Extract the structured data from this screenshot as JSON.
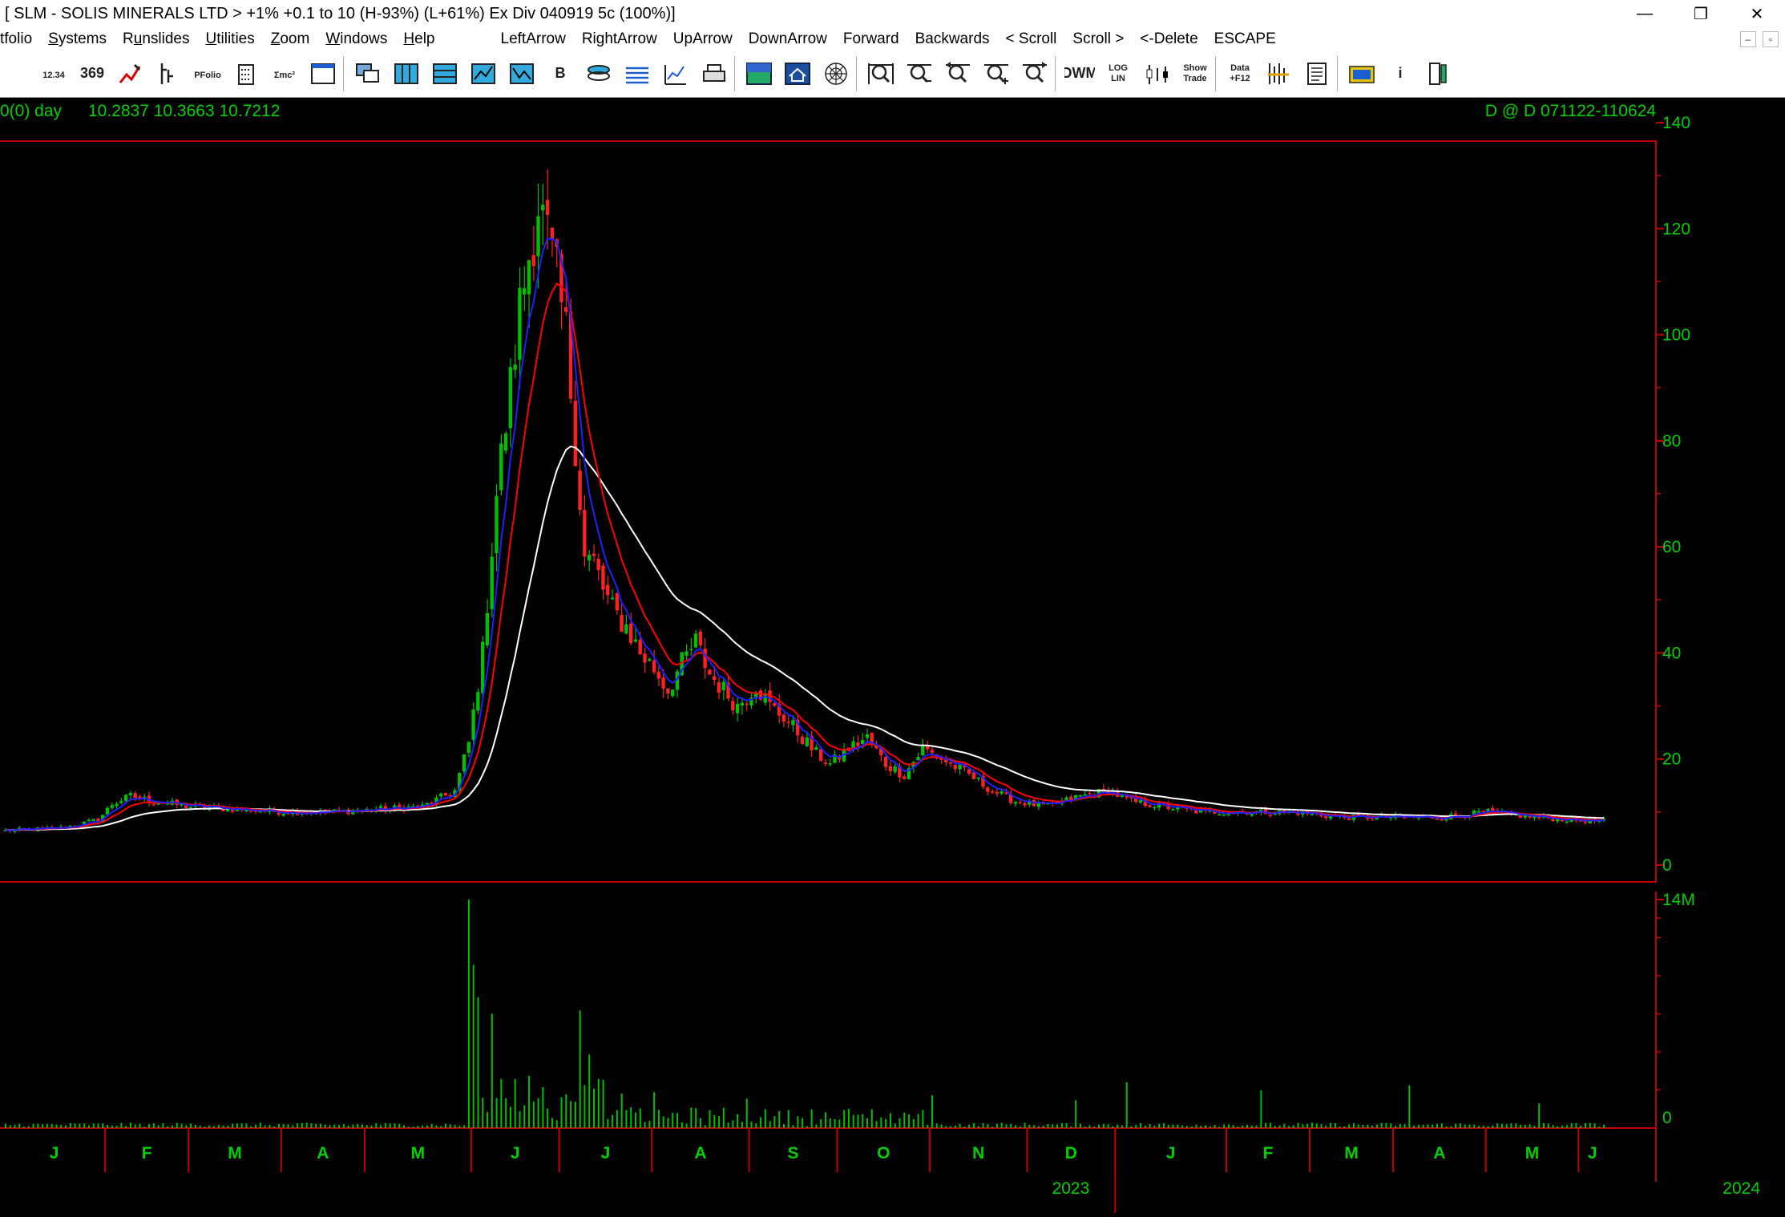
{
  "window": {
    "title": "[ SLM - SOLIS MINERALS LTD > +1% +0.1 to 10 (H-93%) (L+61%)    Ex Div 040919  5c  (100%)]",
    "controls": [
      "—",
      "❐",
      "✕"
    ]
  },
  "menu": {
    "items": [
      {
        "pre": "",
        "ul": "",
        "post": "tfolio"
      },
      {
        "pre": "",
        "ul": "S",
        "post": "ystems"
      },
      {
        "pre": "R",
        "ul": "u",
        "post": "nslides"
      },
      {
        "pre": "",
        "ul": "U",
        "post": "tilities"
      },
      {
        "pre": "",
        "ul": "Z",
        "post": "oom"
      },
      {
        "pre": "",
        "ul": "W",
        "post": "indows"
      },
      {
        "pre": "",
        "ul": "H",
        "post": "elp"
      }
    ],
    "commands": [
      "LeftArrow",
      "RightArrow",
      "UpArrow",
      "DownArrow",
      "Forward",
      "Backwards",
      "< Scroll",
      "Scroll >",
      "<-Delete",
      "ESCAPE"
    ],
    "child_controls": [
      "–",
      "▫"
    ]
  },
  "toolbar": {
    "buttons": [
      {
        "icon": "clock-icon",
        "label": ""
      },
      {
        "icon": "chart-numbers-icon",
        "label": "12.34"
      },
      {
        "icon": "price-table-icon",
        "label": "369"
      },
      {
        "icon": "edit-chart-icon",
        "label": ""
      },
      {
        "icon": "bar-chart-icon",
        "label": ""
      },
      {
        "icon": "portfolio-icon",
        "label": "PFolio"
      },
      {
        "icon": "calculator-icon",
        "label": ""
      },
      {
        "icon": "formula-icon",
        "label": "Σmc²"
      },
      {
        "icon": "window-icon",
        "label": ""
      },
      {
        "icon": "cascade-icon",
        "label": ""
      },
      {
        "icon": "tile-vertical-icon",
        "label": ""
      },
      {
        "icon": "tile-horizontal-icon",
        "label": ""
      },
      {
        "icon": "area-chart-icon",
        "label": ""
      },
      {
        "icon": "volume-chart-icon",
        "label": ""
      },
      {
        "icon": "b-chart-icon",
        "label": "B"
      },
      {
        "icon": "stack-icon",
        "label": ""
      },
      {
        "icon": "layers-icon",
        "label": ""
      },
      {
        "icon": "indicator-icon",
        "label": ""
      },
      {
        "icon": "printer-icon",
        "label": ""
      },
      {
        "icon": "landscape-icon",
        "label": ""
      },
      {
        "icon": "home-icon",
        "label": ""
      },
      {
        "icon": "web-icon",
        "label": ""
      },
      {
        "icon": "zoom-full-icon",
        "label": ""
      },
      {
        "icon": "zoom-out-icon",
        "label": ""
      },
      {
        "icon": "zoom-left-icon",
        "label": ""
      },
      {
        "icon": "zoom-in-icon",
        "label": ""
      },
      {
        "icon": "zoom-right-icon",
        "label": ""
      },
      {
        "icon": "period-dwm-icon",
        "label": "DWM"
      },
      {
        "icon": "log-lin-icon",
        "label": "LOG LIN"
      },
      {
        "icon": "candle-icon",
        "label": ""
      },
      {
        "icon": "show-trade-icon",
        "label": "Show Trade"
      },
      {
        "icon": "data-f12-icon",
        "label": "Data +F12"
      },
      {
        "icon": "signal-icon",
        "label": ""
      },
      {
        "icon": "notes-icon",
        "label": ""
      },
      {
        "icon": "folder-icon",
        "label": ""
      },
      {
        "icon": "info-icon",
        "label": "i"
      },
      {
        "icon": "report-icon",
        "label": ""
      }
    ]
  },
  "chart_header": {
    "left_prefix": "0(0)  day",
    "values": "10.2837  10.3663  10.7212",
    "right": "D @ D   071122-110624"
  },
  "colors": {
    "up": "#00c000",
    "down": "#ff2020",
    "ma_fast": "#2020ff",
    "ma_mid": "#ff0000",
    "ma_slow": "#ffffff",
    "axis": "#00d000",
    "frame": "#c00000",
    "volume": "#00c000"
  },
  "chart_data": {
    "type": "line",
    "price_axis": {
      "ticks": [
        0,
        20,
        40,
        60,
        80,
        100,
        120,
        140
      ],
      "ylim": [
        0,
        140
      ]
    },
    "volume_axis": {
      "ticks": [
        "14M",
        "0"
      ],
      "ylim": [
        0,
        14
      ]
    },
    "x_month_labels": [
      "J",
      "F",
      "M",
      "A",
      "M",
      "J",
      "J",
      "A",
      "S",
      "O",
      "N",
      "D",
      "J",
      "F",
      "M",
      "A",
      "M",
      "J"
    ],
    "year_labels": [
      "2023",
      "2024"
    ],
    "price_path": [
      [
        0,
        6.5
      ],
      [
        12,
        7
      ],
      [
        20,
        8.5
      ],
      [
        23,
        11.5
      ],
      [
        27,
        13
      ],
      [
        32,
        12
      ],
      [
        40,
        11
      ],
      [
        50,
        10.5
      ],
      [
        60,
        10
      ],
      [
        70,
        10
      ],
      [
        80,
        10.5
      ],
      [
        90,
        11
      ],
      [
        97,
        14
      ],
      [
        100,
        23
      ],
      [
        103,
        40
      ],
      [
        106,
        70
      ],
      [
        109,
        90
      ],
      [
        111,
        105
      ],
      [
        113,
        115
      ],
      [
        115,
        125
      ],
      [
        117,
        118
      ],
      [
        119,
        110
      ],
      [
        121,
        100
      ],
      [
        123,
        80
      ],
      [
        125,
        58
      ],
      [
        127,
        57
      ],
      [
        129,
        52
      ],
      [
        131,
        48
      ],
      [
        134,
        45
      ],
      [
        137,
        40
      ],
      [
        140,
        37
      ],
      [
        143,
        33
      ],
      [
        146,
        38
      ],
      [
        149,
        42
      ],
      [
        152,
        36
      ],
      [
        155,
        33
      ],
      [
        158,
        30
      ],
      [
        162,
        34
      ],
      [
        165,
        30
      ],
      [
        168,
        28
      ],
      [
        172,
        24
      ],
      [
        175,
        21
      ],
      [
        178,
        19
      ],
      [
        182,
        22
      ],
      [
        186,
        24
      ],
      [
        190,
        19
      ],
      [
        194,
        17
      ],
      [
        198,
        22
      ],
      [
        202,
        20
      ],
      [
        208,
        17
      ],
      [
        213,
        14
      ],
      [
        218,
        12
      ],
      [
        225,
        11
      ],
      [
        232,
        13
      ],
      [
        238,
        14
      ],
      [
        243,
        12
      ],
      [
        250,
        11
      ],
      [
        258,
        10
      ],
      [
        268,
        10
      ],
      [
        278,
        10
      ],
      [
        288,
        9
      ],
      [
        298,
        9
      ],
      [
        310,
        9
      ],
      [
        320,
        10
      ],
      [
        330,
        9
      ],
      [
        338,
        8.5
      ],
      [
        345,
        8.2
      ]
    ],
    "series": [
      {
        "name": "",
        "period": 5
      },
      {
        "name": "",
        "period": 10
      },
      {
        "name": "",
        "period": 30
      }
    ],
    "volume_spikes": [
      {
        "bar": 100,
        "value": 14
      },
      {
        "bar": 101,
        "value": 10
      },
      {
        "bar": 102,
        "value": 8
      },
      {
        "bar": 105,
        "value": 7
      },
      {
        "bar": 107,
        "value": 3
      },
      {
        "bar": 110,
        "value": 3
      },
      {
        "bar": 113,
        "value": 3.2
      },
      {
        "bar": 116,
        "value": 2.5
      },
      {
        "bar": 124,
        "value": 7.2
      },
      {
        "bar": 126,
        "value": 4.5
      },
      {
        "bar": 128,
        "value": 3
      },
      {
        "bar": 140,
        "value": 2.2
      },
      {
        "bar": 160,
        "value": 1.8
      },
      {
        "bar": 200,
        "value": 2
      },
      {
        "bar": 231,
        "value": 1.7
      },
      {
        "bar": 242,
        "value": 2.8
      },
      {
        "bar": 271,
        "value": 2.3
      },
      {
        "bar": 303,
        "value": 2.6
      },
      {
        "bar": 331,
        "value": 1.5
      }
    ]
  }
}
